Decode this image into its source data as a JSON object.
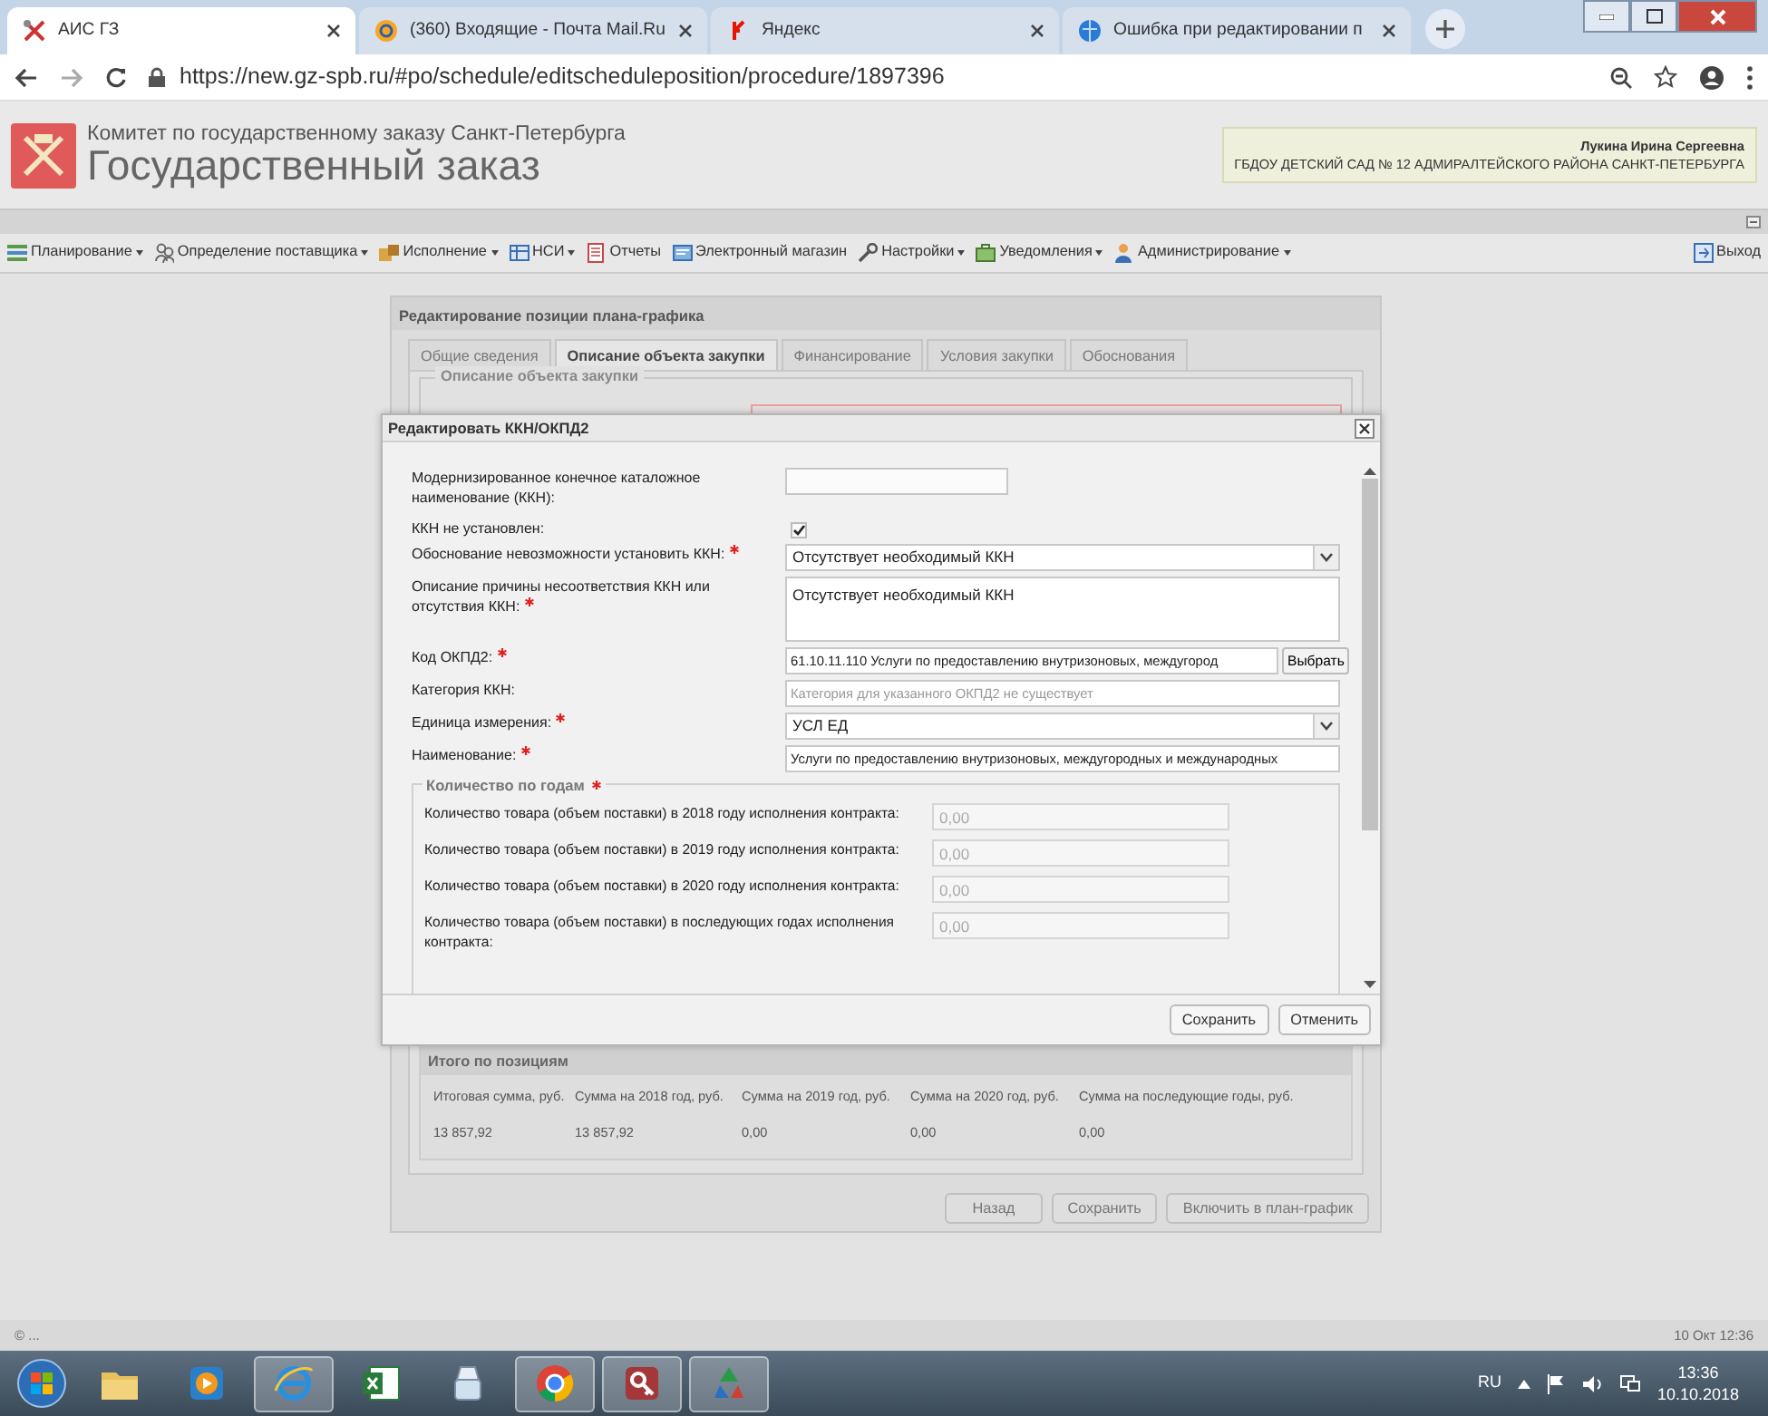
{
  "browser": {
    "tabs": [
      {
        "title": "АИС ГЗ",
        "kind": "emblem",
        "selected": true
      },
      {
        "title": "(360) Входящие - Почта Mail.Ru",
        "kind": "mail",
        "selected": false
      },
      {
        "title": "Яндекс",
        "kind": "letter",
        "selected": false
      },
      {
        "title": "Ошибка при редактировании п",
        "kind": "globe",
        "selected": false
      }
    ],
    "url": "https://new.gz-spb.ru/#po/schedule/editscheduleposition/procedure/1897396"
  },
  "header": {
    "org": "Комитет по государственному заказу Санкт-Петербурга",
    "title": "Государственный заказ",
    "user": {
      "name": "Лукина Ирина Сергеевна",
      "organization": "ГБДОУ ДЕТСКИЙ САД № 12 АДМИРАЛТЕЙСКОГО РАЙОНА САНКТ-ПЕТЕРБУРГА"
    }
  },
  "menu": [
    {
      "label": "Планирование",
      "kind": "list",
      "dropdown": true
    },
    {
      "label": "Определение поставщика",
      "kind": "people",
      "dropdown": true
    },
    {
      "label": "Исполнение",
      "kind": "box",
      "dropdown": true
    },
    {
      "label": "НСИ",
      "kind": "grid",
      "dropdown": true
    },
    {
      "label": "Отчеты",
      "kind": "doc",
      "dropdown": false
    },
    {
      "label": "Электронный магазин",
      "kind": "shop",
      "dropdown": false
    },
    {
      "label": "Настройки",
      "kind": "wrench",
      "dropdown": true
    },
    {
      "label": "Уведомления",
      "kind": "case",
      "dropdown": true
    },
    {
      "label": "Администрирование",
      "kind": "person",
      "dropdown": true
    }
  ],
  "logout": "Выход",
  "panel": {
    "title": "Редактирование позиции плана-графика",
    "tabs": [
      {
        "label": "Общие сведения",
        "selected": false
      },
      {
        "label": "Описание объекта закупки",
        "selected": true
      },
      {
        "label": "Финансирование",
        "selected": false
      },
      {
        "label": "Условия закупки",
        "selected": false
      },
      {
        "label": "Обоснования",
        "selected": false
      }
    ],
    "fieldset_title": "Описание объекта закупки",
    "totals": {
      "title": "Итого по позициям",
      "columns": [
        "Итоговая сумма, руб.",
        "Сумма на 2018 год, руб.",
        "Сумма на 2019 год, руб.",
        "Сумма на 2020 год, руб.",
        "Сумма на последующие годы, руб."
      ],
      "values": [
        "13 857,92",
        "13 857,92",
        "0,00",
        "0,00",
        "0,00"
      ]
    },
    "buttons": [
      "Назад",
      "Сохранить",
      "Включить в план-график"
    ]
  },
  "dialog": {
    "title": "Редактировать ККН/ОКПД2",
    "fields": [
      {
        "label": "Модернизированное конечное каталожное наименование (ККН):",
        "kind": "short",
        "required": false
      },
      {
        "label": "ККН не установлен:",
        "kind": "checkbox",
        "checked": true,
        "required": false
      },
      {
        "label": "Обоснование невозможности установить ККН:",
        "kind": "select",
        "value": "Отсутствует необходимый ККН",
        "required": true
      },
      {
        "label": "Описание причины несоответствия ККН или отсутствия ККН:",
        "kind": "textarea",
        "value": "Отсутствует необходимый ККН",
        "required": true
      },
      {
        "label": "Код ОКПД2:",
        "kind": "picker",
        "value": "61.10.11.110 Услуги по предоставлению внутризоновых, междугород",
        "button": "Выбрать",
        "required": true
      },
      {
        "label": "Категория ККН:",
        "kind": "text",
        "placeholder": "Категория для указанного ОКПД2 не существует",
        "required": false
      },
      {
        "label": "Единица измерения:",
        "kind": "select",
        "value": "УСЛ ЕД",
        "required": true
      },
      {
        "label": "Наименование:",
        "kind": "text",
        "value": "Услуги по предоставлению внутризоновых, междугородных и международных",
        "required": true
      }
    ],
    "quantity": {
      "title": "Количество по годам",
      "required": true,
      "rows": [
        {
          "label": "Количество товара (объем поставки) в 2018 году исполнения контракта:",
          "value": "0,00",
          "disabled": true
        },
        {
          "label": "Количество товара (объем поставки) в 2019 году исполнения контракта:",
          "value": "0,00",
          "disabled": true
        },
        {
          "label": "Количество товара (объем поставки) в 2020 году исполнения контракта:",
          "value": "0,00",
          "disabled": true
        },
        {
          "label": "Количество товара (объем поставки) в последующих годах исполнения контракта:",
          "value": "0,00",
          "disabled": true
        }
      ]
    },
    "buttons": [
      "Сохранить",
      "Отменить"
    ]
  },
  "status_bar": {
    "left": "© ...",
    "right": "10 Окт 12:36"
  },
  "taskbar": {
    "apps": [
      {
        "kind": "folder",
        "open": false
      },
      {
        "kind": "media",
        "open": false
      },
      {
        "kind": "ie",
        "open": true
      },
      {
        "kind": "excel",
        "open": false
      },
      {
        "kind": "scanner",
        "open": false
      },
      {
        "kind": "chrome",
        "open": true
      },
      {
        "kind": "access",
        "open": true
      },
      {
        "kind": "recycle",
        "open": true
      }
    ],
    "language": "RU",
    "time": "13:36",
    "date": "10.10.2018"
  }
}
